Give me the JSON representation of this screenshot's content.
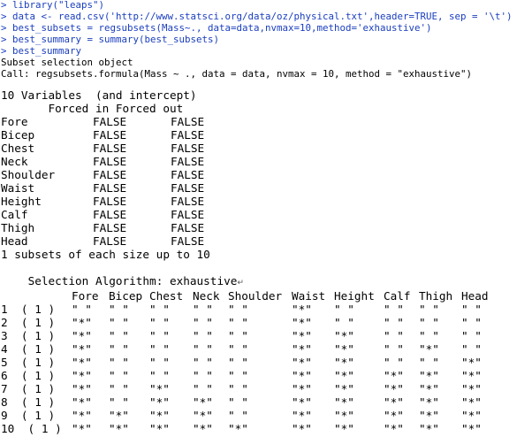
{
  "console": {
    "commands": [
      "> library(\"leaps\")",
      "> data <- read.csv('http://www.statsci.org/data/oz/physical.txt',header=TRUE, sep = '\\t')",
      "> best_subsets = regsubsets(Mass~., data=data,nvmax=10,method='exhaustive')",
      "> best_summary = summary(best_subsets)",
      "> best_summary"
    ],
    "output_header": [
      "Subset selection object",
      "Call: regsubsets.formula(Mass ~ ., data = data, nvmax = 10, method = \"exhaustive\")"
    ],
    "variables_title": "10 Variables  (and intercept)",
    "forced_header": "       Forced in Forced out",
    "forced_rows": [
      {
        "name": "Fore",
        "in": "FALSE",
        "out": "FALSE"
      },
      {
        "name": "Bicep",
        "in": "FALSE",
        "out": "FALSE"
      },
      {
        "name": "Chest",
        "in": "FALSE",
        "out": "FALSE"
      },
      {
        "name": "Neck",
        "in": "FALSE",
        "out": "FALSE"
      },
      {
        "name": "Shoulder",
        "in": "FALSE",
        "out": "FALSE"
      },
      {
        "name": "Waist",
        "in": "FALSE",
        "out": "FALSE"
      },
      {
        "name": "Height",
        "in": "FALSE",
        "out": "FALSE"
      },
      {
        "name": "Calf",
        "in": "FALSE",
        "out": "FALSE"
      },
      {
        "name": "Thigh",
        "in": "FALSE",
        "out": "FALSE"
      },
      {
        "name": "Head",
        "in": "FALSE",
        "out": "FALSE"
      }
    ],
    "subsets_note": "1 subsets of each size up to 10",
    "algorithm_line": "Selection Algorithm: exhaustive",
    "return_mark": "↵",
    "subset_columns": [
      "Fore",
      "Bicep",
      "Chest",
      "Neck",
      "Shoulder",
      "Waist",
      "Height",
      "Calf",
      "Thigh",
      "Head"
    ],
    "subset_rows": [
      {
        "label": "1  ( 1 )",
        "cells": [
          "\" \"",
          "\" \"",
          "\" \"",
          "\" \"",
          "\" \"",
          "\"*\"",
          "\" \"",
          "\" \"",
          "\" \"",
          "\" \""
        ]
      },
      {
        "label": "2  ( 1 )",
        "cells": [
          "\"*\"",
          "\" \"",
          "\" \"",
          "\" \"",
          "\" \"",
          "\"*\"",
          "\" \"",
          "\" \"",
          "\" \"",
          "\" \""
        ]
      },
      {
        "label": "3  ( 1 )",
        "cells": [
          "\"*\"",
          "\" \"",
          "\" \"",
          "\" \"",
          "\" \"",
          "\"*\"",
          "\"*\"",
          "\" \"",
          "\" \"",
          "\" \""
        ]
      },
      {
        "label": "4  ( 1 )",
        "cells": [
          "\"*\"",
          "\" \"",
          "\" \"",
          "\" \"",
          "\" \"",
          "\"*\"",
          "\"*\"",
          "\" \"",
          "\"*\"",
          "\" \""
        ]
      },
      {
        "label": "5  ( 1 )",
        "cells": [
          "\"*\"",
          "\" \"",
          "\" \"",
          "\" \"",
          "\" \"",
          "\"*\"",
          "\"*\"",
          "\" \"",
          "\" \"",
          "\"*\""
        ]
      },
      {
        "label": "6  ( 1 )",
        "cells": [
          "\"*\"",
          "\" \"",
          "\" \"",
          "\" \"",
          "\" \"",
          "\"*\"",
          "\"*\"",
          "\"*\"",
          "\"*\"",
          "\"*\""
        ]
      },
      {
        "label": "7  ( 1 )",
        "cells": [
          "\"*\"",
          "\" \"",
          "\"*\"",
          "\" \"",
          "\" \"",
          "\"*\"",
          "\"*\"",
          "\"*\"",
          "\"*\"",
          "\"*\""
        ]
      },
      {
        "label": "8  ( 1 )",
        "cells": [
          "\"*\"",
          "\" \"",
          "\"*\"",
          "\"*\"",
          "\" \"",
          "\"*\"",
          "\"*\"",
          "\"*\"",
          "\"*\"",
          "\"*\""
        ]
      },
      {
        "label": "9  ( 1 )",
        "cells": [
          "\"*\"",
          "\"*\"",
          "\"*\"",
          "\"*\"",
          "\" \"",
          "\"*\"",
          "\"*\"",
          "\"*\"",
          "\"*\"",
          "\"*\""
        ]
      },
      {
        "label": "10  ( 1 )",
        "cells": [
          "\"*\"",
          "\"*\"",
          "\"*\"",
          "\"*\"",
          "\"*\"",
          "\"*\"",
          "\"*\"",
          "\"*\"",
          "\"*\"",
          "\"*\""
        ]
      }
    ]
  }
}
